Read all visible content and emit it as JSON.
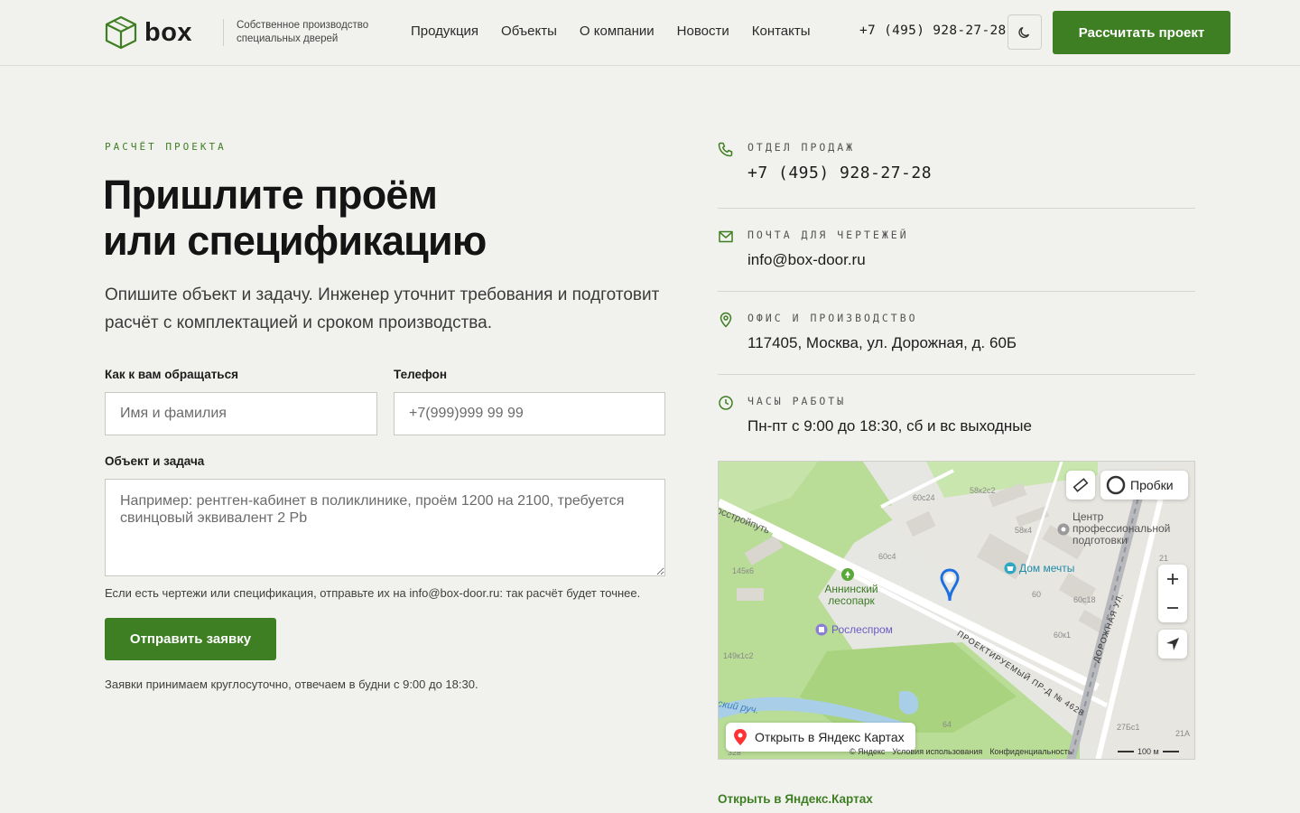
{
  "header": {
    "logo_text": "box",
    "tagline": "Собственное производство специальных дверей",
    "nav": [
      "Продукция",
      "Объекты",
      "О компании",
      "Новости",
      "Контакты"
    ],
    "phone": "+7 (495) 928-27-28",
    "cta_label": "Рассчитать проект"
  },
  "form_section": {
    "eyebrow": "РАСЧЁТ ПРОЕКТА",
    "title_line1": "Пришлите проём",
    "title_line2": "или спецификацию",
    "lead": "Опишите объект и задачу. Инженер уточнит требования и подготовит расчёт с комплектацией и сроком производства.",
    "name_label": "Как к вам обращаться",
    "name_placeholder": "Имя и фамилия",
    "phone_label": "Телефон",
    "phone_placeholder": "+7(999)999 99 99",
    "task_label": "Объект и задача",
    "task_placeholder": "Например: рентген-кабинет в поликлинике, проём 1200 на 2100, требуется свинцовый эквивалент 2 Pb",
    "hint": "Если есть чертежи или спецификация, отправьте их на info@box-door.ru: так расчёт будет точнее.",
    "submit_label": "Отправить заявку",
    "note": "Заявки принимаем круглосуточно, отвечаем в будни с 9:00 до 18:30."
  },
  "contacts": {
    "sales_label": "ОТДЕЛ ПРОДАЖ",
    "sales_phone": "+7 (495) 928-27-28",
    "mail_label": "ПОЧТА ДЛЯ ЧЕРТЕЖЕЙ",
    "mail": "info@box-door.ru",
    "office_label": "ОФИС И ПРОИЗВОДСТВО",
    "office": "117405, Москва, ул. Дорожная, д. 60Б",
    "hours_label": "ЧАСЫ РАБОТЫ",
    "hours": "Пн-пт с 9:00 до 18:30, сб и вс выходные"
  },
  "map": {
    "traffic_label": "Пробки",
    "open_label": "Открыть в Яндекс Картах",
    "place_park": "Аннинский лесопарк",
    "place_dream": "Дом мечты",
    "place_center": "Центр профессиональной подготовки",
    "place_rosles": "Рослеспром",
    "street_road": "ДОРОЖНАЯ УЛ.",
    "street_proj": "ПРОЕКТИРУЕМЫЙ ПР-Д № 4628",
    "street_west": "осстройпуть",
    "stream": "ский руч.",
    "footer_copyright": "© Яндекс",
    "footer_terms": "Условия использования",
    "footer_privacy": "Конфиденциальность",
    "scale": "100 м",
    "houses": [
      "60с24",
      "58к2с2",
      "58к4",
      "60с4",
      "145к6",
      "60",
      "60с18",
      "60к1",
      "149к1с2",
      "64",
      "27Бс1",
      "21",
      "21А",
      "32в"
    ],
    "link_label": "Открыть в Яндекс.Картах"
  },
  "colors": {
    "accent": "#3f7f23",
    "background": "#f1f1ee",
    "park": "#b9dc97"
  },
  "icons": [
    "cube-logo-icon",
    "moon-icon",
    "phone-icon",
    "mail-icon",
    "location-pin-icon",
    "clock-icon",
    "ruler-icon",
    "traffic-icon",
    "zoom-in-icon",
    "zoom-out-icon",
    "locate-icon",
    "map-marker-icon"
  ]
}
